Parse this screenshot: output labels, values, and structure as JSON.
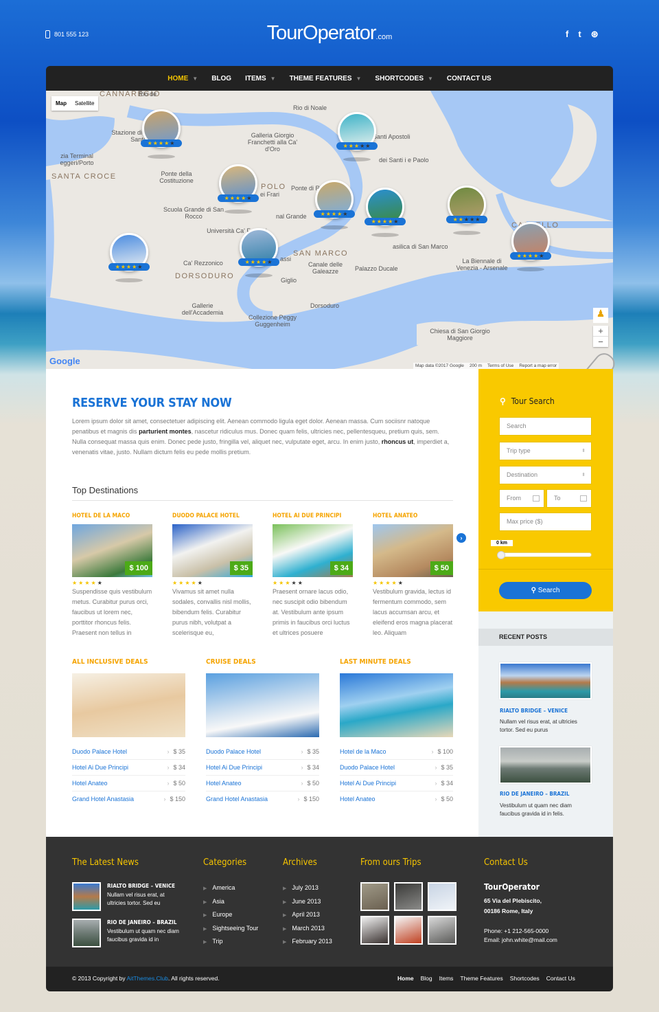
{
  "colors": {
    "accent": "#1a73d6",
    "yellow": "#f9c900",
    "orange": "#f5a400",
    "price_green": "#4caa17",
    "footer": "#333333"
  },
  "header": {
    "phone": "801 555 123",
    "phone_icon": "mobile-phone-icon",
    "logo_main": "TourOperator",
    "logo_suffix": ".com",
    "social": [
      {
        "icon": "facebook-icon",
        "glyph": "f"
      },
      {
        "icon": "twitter-icon",
        "glyph": "t"
      },
      {
        "icon": "dribbble-icon",
        "glyph": "⊛"
      }
    ]
  },
  "nav": {
    "items": [
      {
        "label": "HOME",
        "active": true,
        "dropdown": true
      },
      {
        "label": "BLOG",
        "dropdown": false
      },
      {
        "label": "ITEMS",
        "dropdown": true
      },
      {
        "label": "THEME FEATURES",
        "dropdown": true
      },
      {
        "label": "SHORTCODES",
        "dropdown": true
      },
      {
        "label": "CONTACT US",
        "dropdown": false
      }
    ]
  },
  "map": {
    "type_buttons": [
      "Map",
      "Satellite"
    ],
    "selected_type": "Map",
    "districts": [
      "CANNAREGIO",
      "SANTA CROCE",
      "POLO",
      "SAN MARCO",
      "DORSODURO",
      "CASTELLO"
    ],
    "labels": [
      "Stazione di Venezia Santa",
      "zia Terminal eggeri/Porto",
      "Ponte della Costituzione",
      "Galleria Giorgio Franchetti alla Ca' d'Oro",
      "Santi Apostoli",
      "dei Santi i e Paolo",
      "Ponte di Rialto",
      "ei Frari",
      "nal Grande",
      "Scuola Grande di San Rocco",
      "Università Ca' Foscari",
      "Venezia",
      "asilica di San Marco",
      "Ca' Rezzonico",
      "assi",
      "Canale delle Galeazze",
      "Giglio",
      "Palazzo Ducale",
      "La Biennale di Venezia - Arsenale",
      "Dorsoduro",
      "Gallerie dell'Accademia",
      "Collezione Peggy Guggenheim",
      "Chiesa di San Giorgio Maggiore",
      "Rio de",
      "Rio di Noale"
    ],
    "markers": [
      {
        "stars": 4
      },
      {
        "stars": 3
      },
      {
        "stars": 4
      },
      {
        "stars": 4
      },
      {
        "stars": 4
      },
      {
        "stars": 2
      },
      {
        "stars": 4
      },
      {
        "stars": 4
      },
      {
        "stars": 4
      }
    ],
    "zoom_in": "+",
    "zoom_out": "−",
    "logo": "Google",
    "attribution": [
      "Map data ©2017 Google",
      "200 m",
      "Terms of Use",
      "Report a map error"
    ]
  },
  "intro": {
    "title": "RESERVE YOUR STAY NOW",
    "p1": "Lorem ipsum dolor sit amet, consectetuer adipiscing elit. Aenean commodo ligula eget dolor. Aenean massa. Cum sociisnr natoque penatibus et magnis dis ",
    "b1": "parturient montes",
    "p2": ", nascetur ridiculus mus. Donec quam felis, ultricies nec, pellentesqueu, pretium quis, sem. Nulla consequat massa quis enim. Donec pede justo, fringilla vel, aliquet nec, vulputate eget, arcu. In enim justo, ",
    "b2": "rhoncus ut",
    "p3": ", imperdiet a, venenatis vitae, justo. Nullam dictum felis eu pede mollis pretium."
  },
  "top_destinations": {
    "title": "Top Destinations",
    "next_icon": "chevron-right-icon",
    "hotels": [
      {
        "name": "HOTEL DE LA MACO",
        "price": "$ 100",
        "stars": 4,
        "text": "Suspendisse quis vestibulum metus. Curabitur purus orci, faucibus ut lorem nec, porttitor rhoncus felis. Praesent non tellus in"
      },
      {
        "name": "DUODO PALACE HOTEL",
        "price": "$ 35",
        "stars": 4,
        "text": "Vivamus sit amet nulla sodales, convallis nisl mollis, bibendum felis. Curabitur purus nibh, volutpat a scelerisque eu,"
      },
      {
        "name": "HOTEL AI DUE PRINCIPI",
        "price": "$ 34",
        "stars": 3,
        "text": "Praesent ornare lacus odio, nec suscipit odio bibendum at. Vestibulum ante ipsum primis in faucibus orci luctus et ultrices posuere"
      },
      {
        "name": "HOTEL ANATEO",
        "price": "$ 50",
        "stars": 4,
        "text": "Vestibulum gravida, lectus id fermentum commodo, sem lacus accumsan arcu, et eleifend eros magna placerat leo. Aliquam"
      }
    ]
  },
  "deals": [
    {
      "title": "ALL INCLUSIVE DEALS",
      "items": [
        {
          "name": "Duodo Palace Hotel",
          "price": "$ 35"
        },
        {
          "name": "Hotel Ai Due Principi",
          "price": "$ 34"
        },
        {
          "name": "Hotel Anateo",
          "price": "$ 50"
        },
        {
          "name": "Grand Hotel Anastasia",
          "price": "$ 150"
        }
      ]
    },
    {
      "title": "CRUISE DEALS",
      "items": [
        {
          "name": "Duodo Palace Hotel",
          "price": "$ 35"
        },
        {
          "name": "Hotel Ai Due Principi",
          "price": "$ 34"
        },
        {
          "name": "Hotel Anateo",
          "price": "$ 50"
        },
        {
          "name": "Grand Hotel Anastasia",
          "price": "$ 150"
        }
      ]
    },
    {
      "title": "LAST MINUTE DEALS",
      "items": [
        {
          "name": "Hotel de la Maco",
          "price": "$ 100"
        },
        {
          "name": "Duodo Palace Hotel",
          "price": "$ 35"
        },
        {
          "name": "Hotel Ai Due Principi",
          "price": "$ 34"
        },
        {
          "name": "Hotel Anateo",
          "price": "$ 50"
        }
      ]
    }
  ],
  "tour_search": {
    "title": "Tour Search",
    "search_placeholder": "Search",
    "trip_type": "Trip type",
    "destination": "Destination",
    "from": "From",
    "to": "To",
    "max_price": "Max price ($)",
    "distance": "0 km",
    "distance_value": 0,
    "button": "Search"
  },
  "recent_posts": {
    "title": "RECENT POSTS",
    "posts": [
      {
        "title": "RIALTO BRIDGE – VENICE",
        "text": "Nullam vel risus erat, at ultricies tortor. Sed eu purus"
      },
      {
        "title": "RIO DE JANEIRO – BRAZIL",
        "text": "Vestibulum ut quam nec diam faucibus gravida id in felis."
      }
    ]
  },
  "footer": {
    "news": {
      "title": "The Latest News",
      "items": [
        {
          "title": "RIALTO BRIDGE – VENICE",
          "text": "Nullam vel risus erat, at ultricies tortor. Sed eu"
        },
        {
          "title": "RIO DE JANEIRO – BRAZIL",
          "text": "Vestibulum ut quam nec diam faucibus gravida id in"
        }
      ]
    },
    "categories": {
      "title": "Categories",
      "items": [
        "America",
        "Asia",
        "Europe",
        "Sightseeing Tour",
        "Trip"
      ]
    },
    "archives": {
      "title": "Archives",
      "items": [
        "July 2013",
        "June 2013",
        "April 2013",
        "March 2013",
        "February 2013"
      ]
    },
    "trips": {
      "title": "From ours Trips"
    },
    "contact": {
      "title": "Contact Us",
      "name": "TourOperator",
      "address1": "65 Via del Plebiscito,",
      "address2": "00186 Rome, Italy",
      "phone": "Phone: +1 212-565-0000",
      "email": "Email: john.white@mail.com"
    },
    "copyright_pre": "© 2013 Copyright by ",
    "copyright_link": "AitThemes.Club",
    "copyright_post": ". All rights reserved.",
    "links": [
      "Home",
      "Blog",
      "Items",
      "Theme Features",
      "Shortcodes",
      "Contact Us"
    ]
  }
}
